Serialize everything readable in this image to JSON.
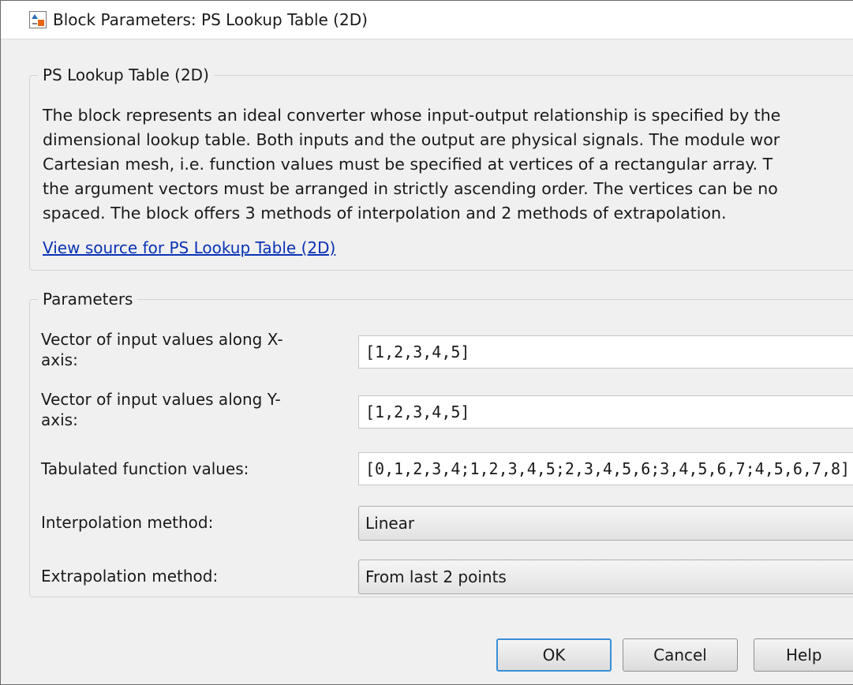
{
  "window": {
    "title": "Block Parameters: PS Lookup Table (2D)"
  },
  "description_group": {
    "legend": "PS Lookup Table (2D)",
    "lines": [
      "The block represents an ideal converter whose input-output relationship is specified by the",
      "dimensional lookup table. Both inputs and the output are physical signals. The module wor",
      "Cartesian mesh, i.e. function values must be specified at vertices of a rectangular array. T",
      "the argument vectors must be arranged in strictly ascending order. The vertices can be no",
      "spaced. The block offers 3 methods of interpolation and 2 methods of extrapolation."
    ],
    "source_link": "View source for PS Lookup Table (2D)"
  },
  "parameters": {
    "legend": "Parameters",
    "x_vector": {
      "label_line1": "Vector of input values along X-",
      "label_line2": "axis:",
      "value": "[1,2,3,4,5]"
    },
    "y_vector": {
      "label_line1": "Vector of input values along Y-",
      "label_line2": "axis:",
      "value": "[1,2,3,4,5]"
    },
    "table": {
      "label": "Tabulated function values:",
      "value": "[0,1,2,3,4;1,2,3,4,5;2,3,4,5,6;3,4,5,6,7;4,5,6,7,8]"
    },
    "interpolation": {
      "label": "Interpolation method:",
      "value": "Linear"
    },
    "extrapolation": {
      "label": "Extrapolation method:",
      "value": "From last 2 points"
    }
  },
  "buttons": {
    "ok": "OK",
    "cancel": "Cancel",
    "help": "Help"
  },
  "colors": {
    "link": "#0b32b5",
    "default_button_border": "#3a8ed6",
    "icon_orange": "#e8651a",
    "icon_blue": "#2b6cb8"
  },
  "icons": {
    "app": "simulink-block-icon"
  }
}
